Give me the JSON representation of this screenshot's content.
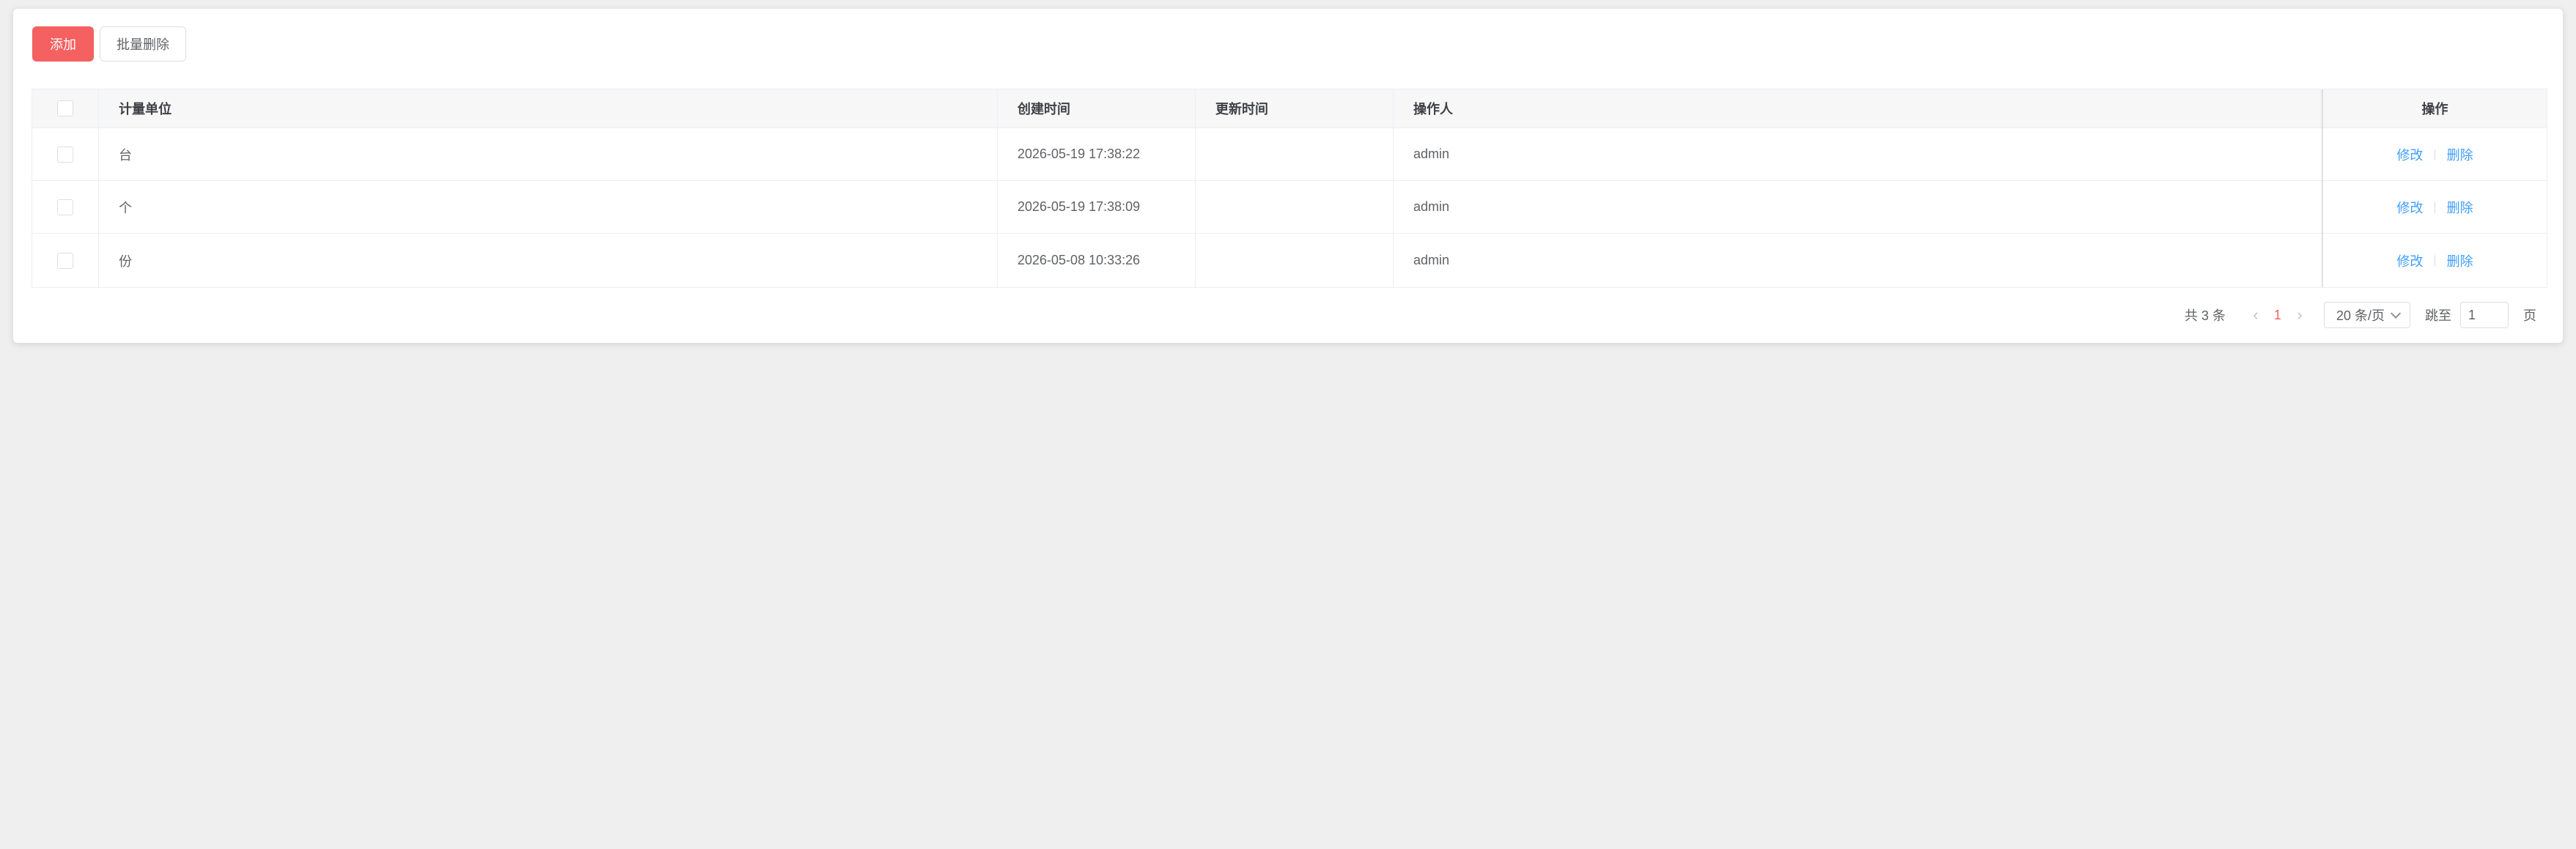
{
  "toolbar": {
    "add_label": "添加",
    "batch_delete_label": "批量删除"
  },
  "table": {
    "columns": {
      "unit": "计量单位",
      "created": "创建时间",
      "updated": "更新时间",
      "operator": "操作人",
      "actions": "操作"
    },
    "rows": [
      {
        "unit": "台",
        "created": "2026-05-19 17:38:22",
        "updated": "",
        "operator": "admin",
        "edit": "修改",
        "delete": "删除"
      },
      {
        "unit": "个",
        "created": "2026-05-19 17:38:09",
        "updated": "",
        "operator": "admin",
        "edit": "修改",
        "delete": "删除"
      },
      {
        "unit": "份",
        "created": "2026-05-08 10:33:26",
        "updated": "",
        "operator": "admin",
        "edit": "修改",
        "delete": "删除"
      }
    ]
  },
  "pagination": {
    "total_text": "共 3 条",
    "current_page": "1",
    "page_size": "20 条/页",
    "jump_label": "跳至",
    "jump_value": "1",
    "jump_suffix": "页"
  },
  "colors": {
    "accent": "#f56060",
    "link": "#409eff",
    "background": "#efefef"
  }
}
